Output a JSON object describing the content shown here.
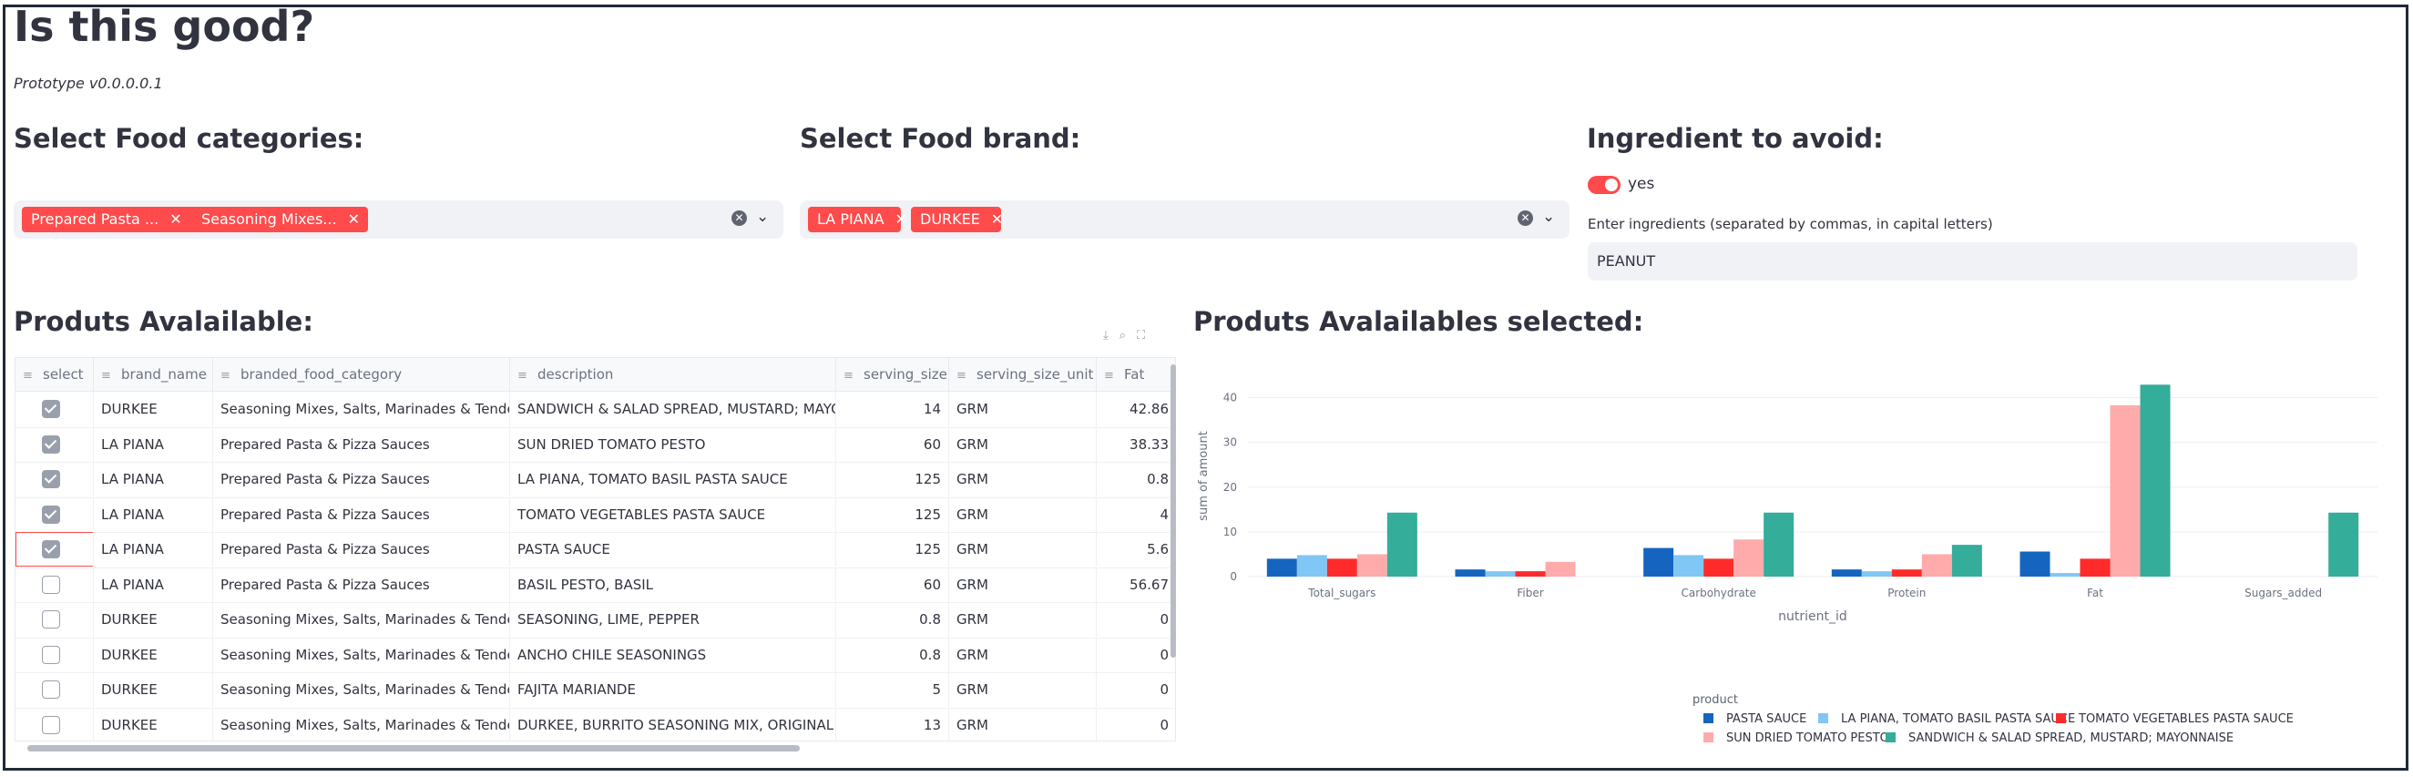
{
  "header": {
    "title": "Is this good?",
    "subtitle": "Prototype v0.0.0.0.1"
  },
  "filters": {
    "categories_label": "Select Food categories:",
    "categories_selected": [
      "Prepared Pasta ...",
      "Seasoning Mixes..."
    ],
    "brand_label": "Select Food brand:",
    "brands_selected": [
      "LA PIANA",
      "DURKEE"
    ],
    "ingredient_label": "Ingredient to avoid:",
    "toggle_label": "yes",
    "toggle_on": true,
    "input_label": "Enter ingredients (separated by commas, in capital letters)",
    "input_value": "PEANUT"
  },
  "table": {
    "heading": "Produts Avalailable:",
    "columns": [
      "select",
      "brand_name",
      "branded_food_category",
      "description",
      "serving_size",
      "serving_size_unit",
      "Fat"
    ],
    "rows": [
      {
        "select": true,
        "brand_name": "DURKEE",
        "category": "Seasoning Mixes, Salts, Marinades & Tenderizers",
        "description": "SANDWICH & SALAD SPREAD, MUSTARD; MAYONNAISE",
        "serving_size": "14",
        "unit": "GRM",
        "fat": "42.86"
      },
      {
        "select": true,
        "brand_name": "LA PIANA",
        "category": "Prepared Pasta & Pizza Sauces",
        "description": "SUN DRIED TOMATO PESTO",
        "serving_size": "60",
        "unit": "GRM",
        "fat": "38.33"
      },
      {
        "select": true,
        "brand_name": "LA PIANA",
        "category": "Prepared Pasta & Pizza Sauces",
        "description": "LA PIANA, TOMATO BASIL PASTA SAUCE",
        "serving_size": "125",
        "unit": "GRM",
        "fat": "0.8"
      },
      {
        "select": true,
        "brand_name": "LA PIANA",
        "category": "Prepared Pasta & Pizza Sauces",
        "description": "TOMATO VEGETABLES PASTA SAUCE",
        "serving_size": "125",
        "unit": "GRM",
        "fat": "4"
      },
      {
        "select": true,
        "brand_name": "LA PIANA",
        "category": "Prepared Pasta & Pizza Sauces",
        "description": "PASTA SAUCE",
        "serving_size": "125",
        "unit": "GRM",
        "fat": "5.6"
      },
      {
        "select": false,
        "brand_name": "LA PIANA",
        "category": "Prepared Pasta & Pizza Sauces",
        "description": "BASIL PESTO, BASIL",
        "serving_size": "60",
        "unit": "GRM",
        "fat": "56.67"
      },
      {
        "select": false,
        "brand_name": "DURKEE",
        "category": "Seasoning Mixes, Salts, Marinades & Tenderizers",
        "description": "SEASONING, LIME, PEPPER",
        "serving_size": "0.8",
        "unit": "GRM",
        "fat": "0"
      },
      {
        "select": false,
        "brand_name": "DURKEE",
        "category": "Seasoning Mixes, Salts, Marinades & Tenderizers",
        "description": "ANCHO CHILE SEASONINGS",
        "serving_size": "0.8",
        "unit": "GRM",
        "fat": "0"
      },
      {
        "select": false,
        "brand_name": "DURKEE",
        "category": "Seasoning Mixes, Salts, Marinades & Tenderizers",
        "description": "FAJITA MARIANDE",
        "serving_size": "5",
        "unit": "GRM",
        "fat": "0"
      },
      {
        "select": false,
        "brand_name": "DURKEE",
        "category": "Seasoning Mixes, Salts, Marinades & Tenderizers",
        "description": "DURKEE, BURRITO SEASONING MIX, ORIGINAL",
        "serving_size": "13",
        "unit": "GRM",
        "fat": "0"
      }
    ],
    "toolbar_icons": [
      "download-icon",
      "search-icon",
      "fullscreen-icon"
    ]
  },
  "chart_heading": "Produts Avalailables selected:",
  "chart_data": {
    "type": "bar",
    "categories": [
      "Total_sugars",
      "Fiber",
      "Carbohydrate",
      "Protein",
      "Fat",
      "Sugars_added"
    ],
    "xlabel": "nutrient_id",
    "ylabel": "sum of amount",
    "ylim": [
      0,
      45
    ],
    "yticks": [
      0,
      10,
      20,
      30,
      40
    ],
    "legend_title": "product",
    "legend_placement": "bottom",
    "grid": true,
    "series": [
      {
        "name": "PASTA SAUCE",
        "color": "#1565c0",
        "values": [
          4,
          1.6,
          6.4,
          1.6,
          5.6,
          0
        ]
      },
      {
        "name": "LA PIANA, TOMATO BASIL PASTA SAUCE",
        "color": "#81c7f5",
        "values": [
          4.8,
          1.2,
          4.8,
          1.2,
          0.8,
          0
        ]
      },
      {
        "name": "TOMATO VEGETABLES PASTA SAUCE",
        "color": "#ff2b2b",
        "values": [
          4,
          1.2,
          4,
          1.6,
          4,
          0
        ]
      },
      {
        "name": "SUN DRIED TOMATO PESTO",
        "color": "#ffabab",
        "values": [
          5,
          3.3,
          8.3,
          5,
          38.3,
          0
        ]
      },
      {
        "name": "SANDWICH & SALAD SPREAD, MUSTARD; MAYONNAISE",
        "color": "#34ad9a",
        "values": [
          14.3,
          0,
          14.3,
          7.1,
          42.9,
          14.3
        ]
      }
    ]
  }
}
